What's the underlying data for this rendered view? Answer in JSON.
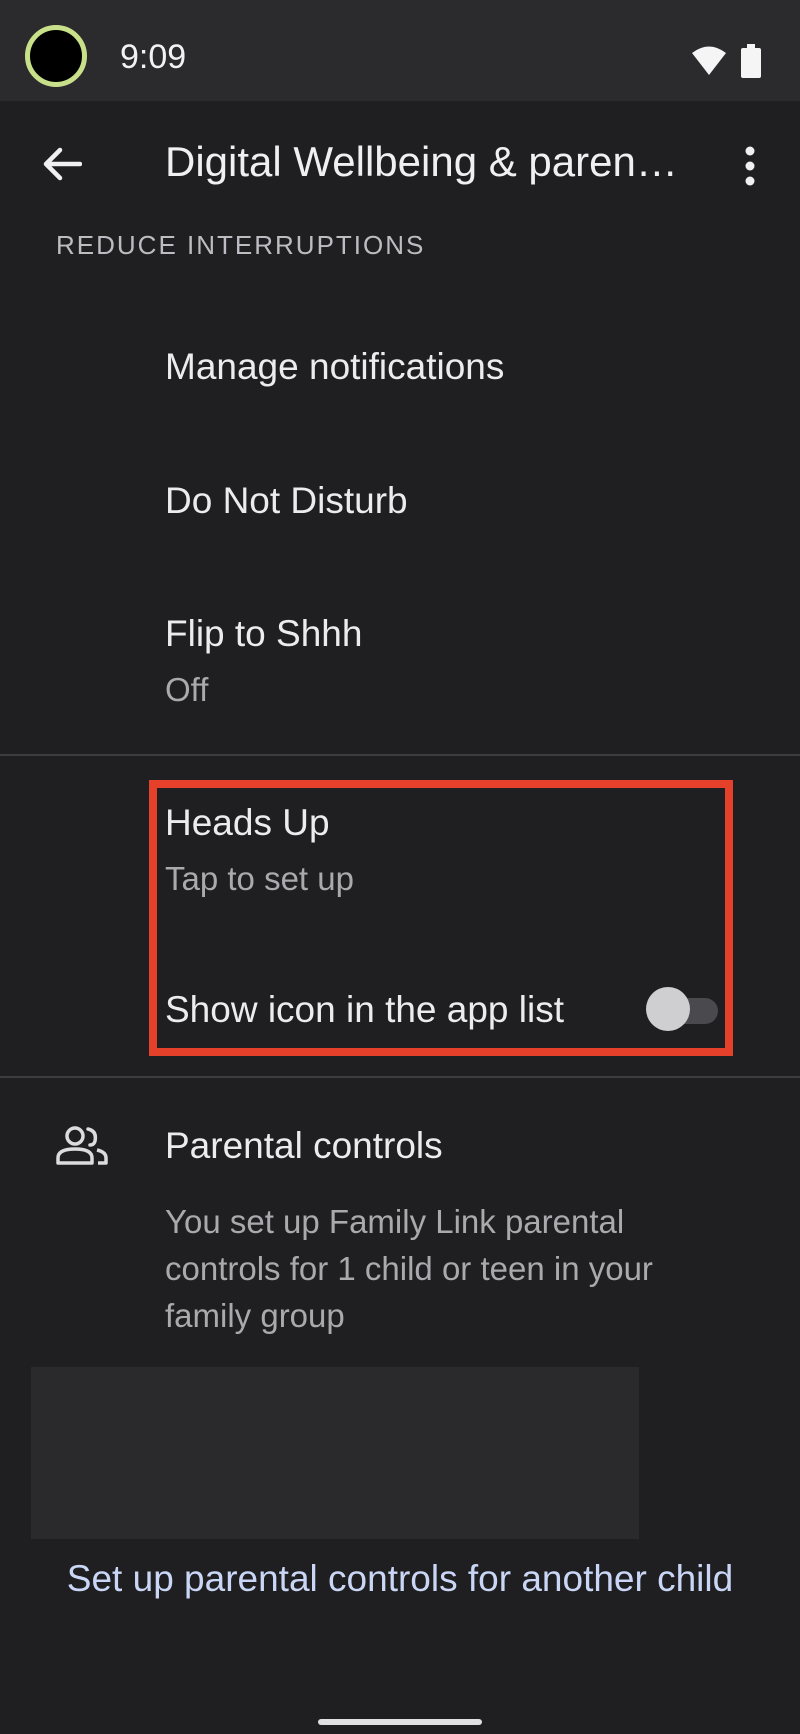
{
  "status_bar": {
    "time": "9:09"
  },
  "header": {
    "title": "Digital Wellbeing & parental controls"
  },
  "section": {
    "label": "REDUCE INTERRUPTIONS"
  },
  "items": {
    "manage_notifications": {
      "title": "Manage notifications"
    },
    "do_not_disturb": {
      "title": "Do Not Disturb"
    },
    "flip_to_shhh": {
      "title": "Flip to Shhh",
      "summary": "Off"
    },
    "heads_up": {
      "title": "Heads Up",
      "summary": "Tap to set up"
    },
    "show_icon": {
      "title": "Show icon in the app list",
      "enabled": false
    },
    "parental_controls": {
      "title": "Parental controls",
      "summary": "You set up Family Link parental controls for 1 child or teen in your family group"
    }
  },
  "actions": {
    "setup_another": "Set up parental controls for another child"
  },
  "colors": {
    "highlight": "#e4402a",
    "accent_ring": "#c9e08a",
    "link": "#c9d6f5"
  }
}
